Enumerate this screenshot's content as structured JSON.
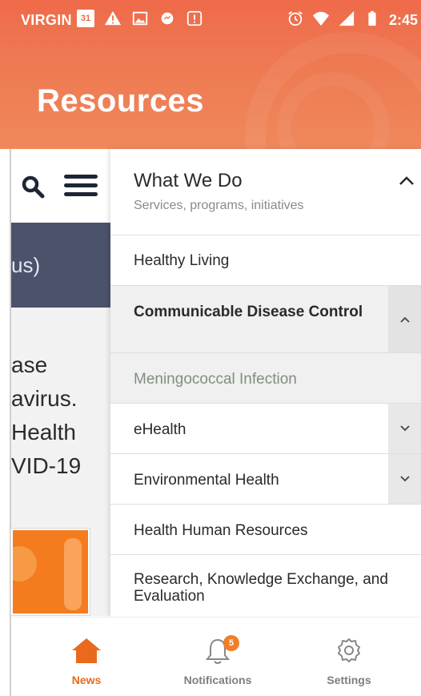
{
  "status_bar": {
    "carrier": "VIRGIN",
    "calendar_day": "31",
    "time": "2:45"
  },
  "header": {
    "title": "Resources"
  },
  "background_content": {
    "dark_banner_fragment": "us)",
    "text_fragments": [
      "ase",
      "avirus.",
      "Health",
      "VID-19"
    ]
  },
  "drawer": {
    "section": {
      "title": "What We Do",
      "subtitle": "Services, programs, initiatives"
    },
    "items": [
      {
        "label": "Healthy Living"
      },
      {
        "label": "Communicable Disease Control"
      },
      {
        "label": "Meningococcal Infection"
      },
      {
        "label": "eHealth"
      },
      {
        "label": "Environmental Health"
      },
      {
        "label": "Health Human Resources"
      },
      {
        "label": "Research, Knowledge Exchange, and Evaluation"
      }
    ]
  },
  "bottom_nav": {
    "news": "News",
    "notifications": "Notifications",
    "notifications_badge": "5",
    "settings": "Settings"
  },
  "colors": {
    "header_orange": "#ef6a4a",
    "active_nav": "#e96a1c",
    "inactive_nav": "#7e7e7e",
    "badge": "#f07e2a"
  }
}
